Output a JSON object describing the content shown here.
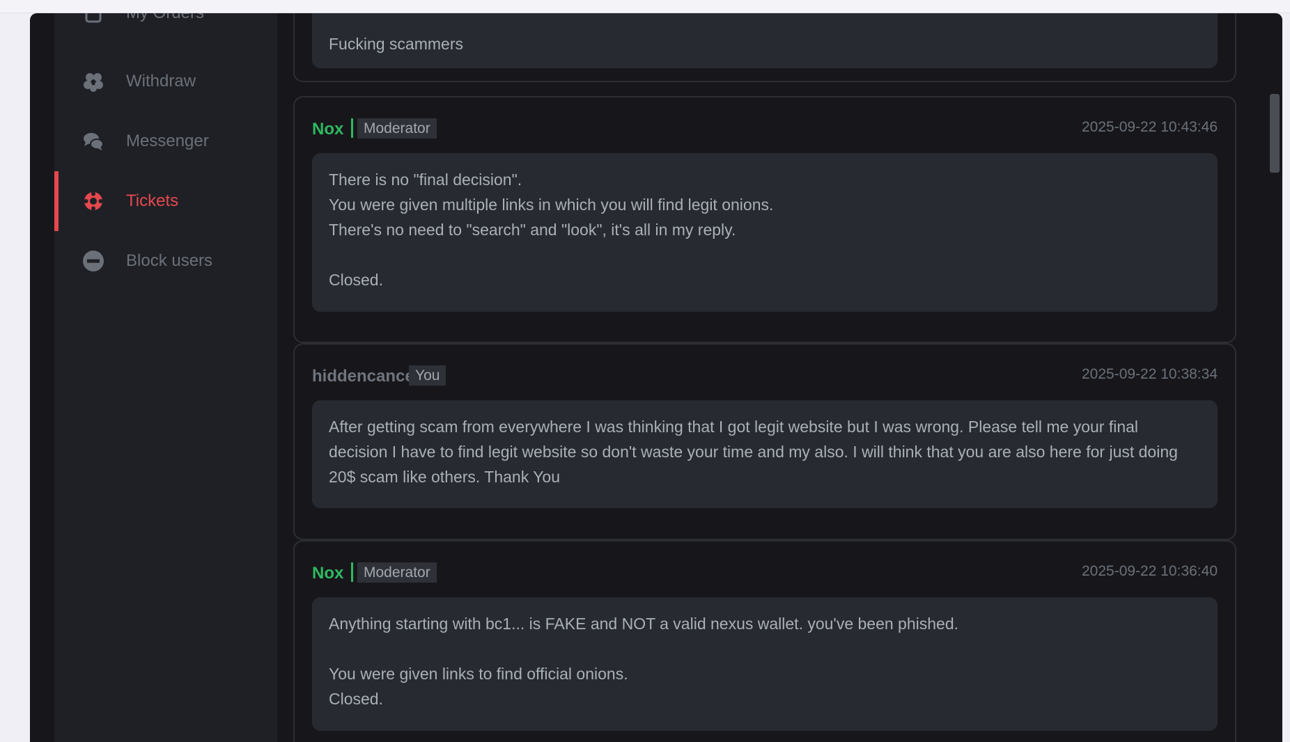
{
  "sidebar": {
    "items": [
      {
        "label": "My Orders",
        "icon": "orders-icon"
      },
      {
        "label": "Withdraw",
        "icon": "cubes-icon"
      },
      {
        "label": "Messenger",
        "icon": "chat-bubbles-icon"
      },
      {
        "label": "Tickets",
        "icon": "lifebuoy-icon",
        "active": true
      },
      {
        "label": "Block users",
        "icon": "minus-circle-icon"
      }
    ]
  },
  "messages": [
    {
      "text": "Fucking scammers"
    },
    {
      "author": "Nox",
      "role": "Moderator",
      "timestamp": "2025-09-22 10:43:46",
      "text": "There is no \"final decision\".\nYou were given multiple links in which you will find legit onions.\nThere's no need to \"search\" and \"look\", it's all in my reply.\n\nClosed."
    },
    {
      "author": "hiddencancer",
      "role": "You",
      "timestamp": "2025-09-22 10:38:34",
      "text": "After getting scam from everywhere I was thinking that I got legit website but I was wrong. Please tell me your final decision I have to find legit website so don't waste your time and my also. I will think that you are also here for just doing 20$ scam like others. Thank You"
    },
    {
      "author": "Nox",
      "role": "Moderator",
      "timestamp": "2025-09-22 10:36:40",
      "text": "Anything starting with bc1... is FAKE and NOT a valid nexus wallet. you've been phished.\n\nYou were given links to find official onions.\nClosed."
    }
  ],
  "colors": {
    "accent_red": "#e5484d",
    "moderator_green": "#2fb861",
    "background": "#17171b",
    "sidebar": "#1f2025",
    "message_bg": "#272a30"
  }
}
